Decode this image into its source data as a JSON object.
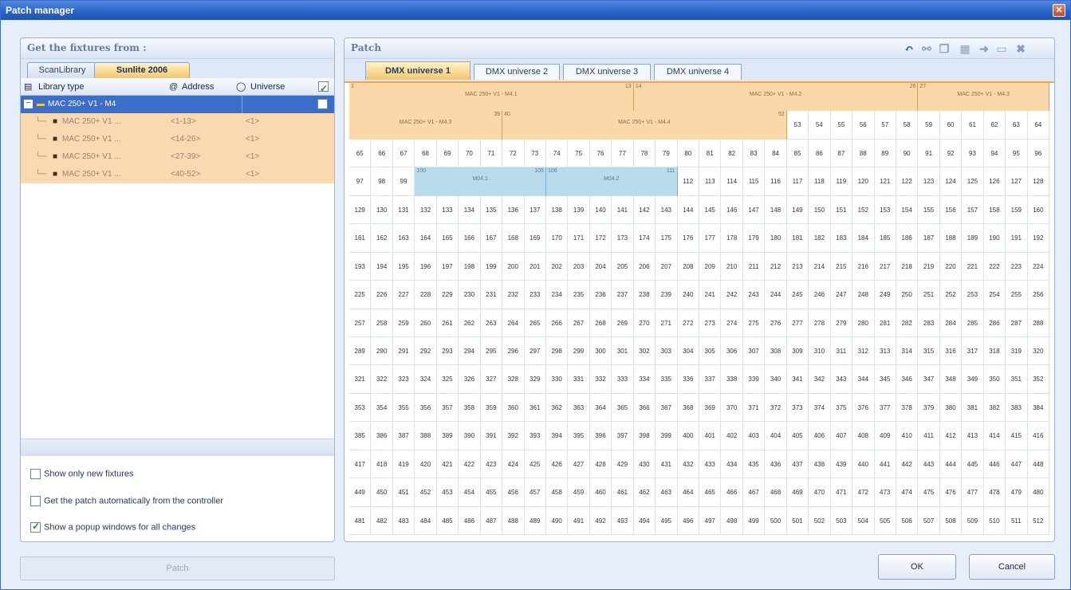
{
  "window": {
    "title": "Patch manager"
  },
  "left": {
    "header": "Get the fixtures from :",
    "tabs": [
      "ScanLibrary",
      "Sunlite 2006"
    ],
    "active_tab": "Sunlite 2006",
    "columns": {
      "type": "Library type",
      "address": "Address",
      "universe": "Universe"
    },
    "root": {
      "label": "MAC 250+ V1 - M4"
    },
    "children": [
      {
        "label": "MAC 250+ V1 ...",
        "address": "<1-13>",
        "universe": "<1>"
      },
      {
        "label": "MAC 250+ V1 ...",
        "address": "<14-26>",
        "universe": "<1>"
      },
      {
        "label": "MAC 250+ V1 ...",
        "address": "<27-39>",
        "universe": "<1>"
      },
      {
        "label": "MAC 250+ V1 ...",
        "address": "<40-52>",
        "universe": "<1>"
      }
    ],
    "options": [
      {
        "label": "Show only new fixtures",
        "checked": false
      },
      {
        "label": "Get the patch automatically from the controller",
        "checked": false
      },
      {
        "label": "Show a popup windows for all changes",
        "checked": true
      }
    ],
    "patch_button": "Patch"
  },
  "right": {
    "header": "Patch",
    "tabs": [
      "DMX universe 1",
      "DMX universe 2",
      "DMX universe 3",
      "DMX universe 4"
    ],
    "active_tab": "DMX universe 1",
    "toolbar_icons": [
      "undo-icon",
      "link-icon",
      "copy-icon",
      "stack-icon",
      "arrow-icon",
      "window-icon",
      "close-icon"
    ],
    "fixtures": [
      {
        "start": 1,
        "end": 13,
        "label": "MAC 250+ V1 - M4.1",
        "color": "orange"
      },
      {
        "start": 14,
        "end": 26,
        "label": "MAC 250+ V1 - M4.2",
        "color": "orange"
      },
      {
        "start": 27,
        "end": 39,
        "label": "MAC 250+ V1 - M4.3",
        "color": "orange"
      },
      {
        "start": 40,
        "end": 52,
        "label": "MAC 250+ V1 - M4.4",
        "color": "orange"
      },
      {
        "start": 100,
        "end": 105,
        "label": "M04.1",
        "color": "blue"
      },
      {
        "start": 106,
        "end": 111,
        "label": "M04.2",
        "color": "blue"
      }
    ],
    "channels": 512,
    "columns": 32
  },
  "buttons": {
    "ok": "OK",
    "cancel": "Cancel"
  }
}
